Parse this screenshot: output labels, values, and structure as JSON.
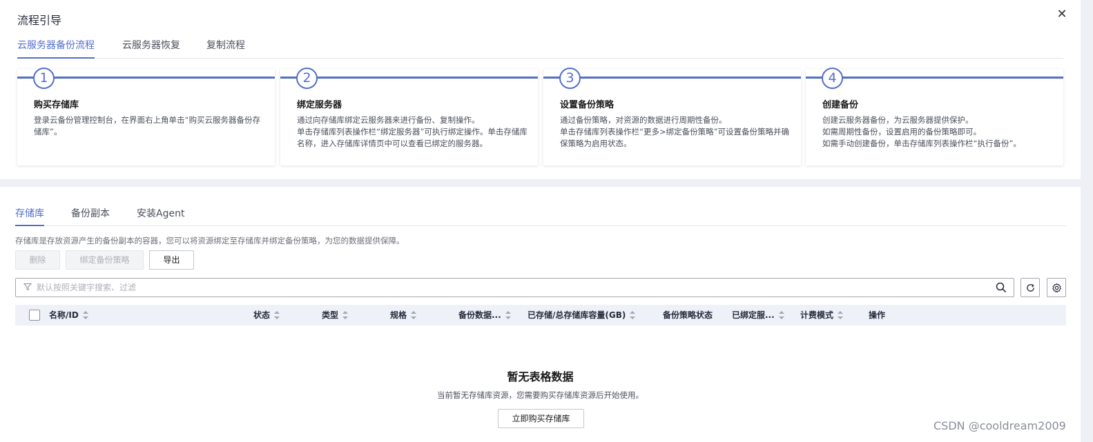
{
  "guide": {
    "title": "流程引导",
    "close_glyph": "✕",
    "tabs": [
      "云服务器备份流程",
      "云服务器恢复",
      "复制流程"
    ],
    "steps": [
      {
        "num": "1",
        "title": "购买存储库",
        "lines": [
          "登录云备份管理控制台，在界面右上角单击“购买云服务器备份存储库”。"
        ]
      },
      {
        "num": "2",
        "title": "绑定服务器",
        "lines": [
          "通过向存储库绑定云服务器来进行备份、复制操作。",
          "单击存储库列表操作栏“绑定服务器”可执行绑定操作。单击存储库名称，进入存储库详情页中可以查看已绑定的服务器。"
        ]
      },
      {
        "num": "3",
        "title": "设置备份策略",
        "lines": [
          "通过备份策略，对资源的数据进行周期性备份。",
          "单击存储库列表操作栏“更多>绑定备份策略”可设置备份策略并确保策略为启用状态。"
        ]
      },
      {
        "num": "4",
        "title": "创建备份",
        "lines": [
          "创建云服务器备份，为云服务器提供保护。",
          "如需周期性备份，设置启用的备份策略即可。",
          "如需手动创建备份，单击存储库列表操作栏“执行备份”。"
        ]
      }
    ]
  },
  "main": {
    "tabs": [
      "存储库",
      "备份副本",
      "安装Agent"
    ],
    "description": "存储库是存放资源产生的备份副本的容器，您可以将资源绑定至存储库并绑定备份策略，为您的数据提供保障。",
    "buttons": {
      "delete": "删除",
      "bind_policy": "绑定备份策略",
      "export": "导出"
    },
    "search_placeholder": "默认按照关键字搜索、过滤",
    "columns": [
      "名称/ID",
      "状态",
      "类型",
      "规格",
      "备份数据...",
      "已存储/总存储库容量(GB)",
      "备份策略状态",
      "已绑定服...",
      "计费模式",
      "操作"
    ],
    "empty": {
      "title": "暂无表格数据",
      "desc": "当前暂无存储库资源，您需要购买存储库资源后开始使用。",
      "buy_button": "立即购买存储库"
    }
  },
  "watermark": "CSDN @cooldream2009",
  "colors": {
    "accent": "#526ecc",
    "header_bg": "#eef1f8"
  }
}
